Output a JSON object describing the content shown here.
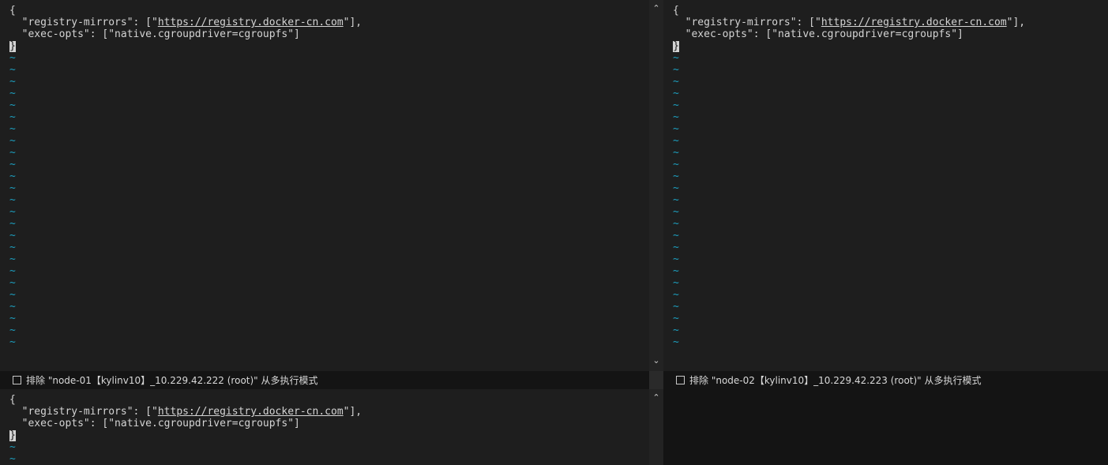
{
  "panes": [
    {
      "lines": [
        "{",
        "  \"registry-mirrors\": [\"",
        "  \"exec-opts\": [\"native.cgroupdriver=cgroupfs\"]",
        "}"
      ],
      "url": "https://registry.docker-cn.com",
      "url_suffix": "\"],"
    },
    {
      "lines": [
        "{",
        "  \"registry-mirrors\": [\"",
        "  \"exec-opts\": [\"native.cgroupdriver=cgroupfs\"]",
        "}"
      ],
      "url": "https://registry.docker-cn.com",
      "url_suffix": "\"],"
    },
    {
      "lines": [
        "{",
        "  \"registry-mirrors\": [\"",
        "  \"exec-opts\": [\"native.cgroupdriver=cgroupfs\"]",
        "}"
      ],
      "url": "https://registry.docker-cn.com",
      "url_suffix": "\"],"
    }
  ],
  "tilde": "~",
  "status_bars": [
    {
      "label": "排除 \"node-01【kylinv10】_10.229.42.222 (root)\" 从多执行模式"
    },
    {
      "label": "排除 \"node-02【kylinv10】_10.229.42.223 (root)\" 从多执行模式"
    }
  ],
  "scroll_up": "⌃",
  "scroll_down": "⌄",
  "colors": {
    "tilde": "#1d9fbf",
    "text": "#d4d4d4",
    "background": "#1e1e1e"
  }
}
